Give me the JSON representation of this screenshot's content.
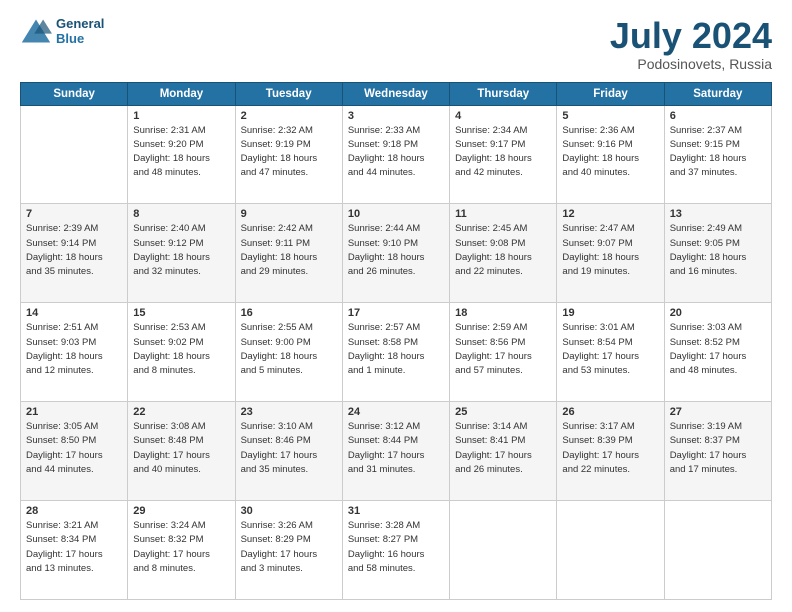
{
  "logo": {
    "line1": "General",
    "line2": "Blue"
  },
  "title": "July 2024",
  "subtitle": "Podosinovets, Russia",
  "header_days": [
    "Sunday",
    "Monday",
    "Tuesday",
    "Wednesday",
    "Thursday",
    "Friday",
    "Saturday"
  ],
  "weeks": [
    [
      {
        "day": "",
        "info": ""
      },
      {
        "day": "1",
        "info": "Sunrise: 2:31 AM\nSunset: 9:20 PM\nDaylight: 18 hours\nand 48 minutes."
      },
      {
        "day": "2",
        "info": "Sunrise: 2:32 AM\nSunset: 9:19 PM\nDaylight: 18 hours\nand 47 minutes."
      },
      {
        "day": "3",
        "info": "Sunrise: 2:33 AM\nSunset: 9:18 PM\nDaylight: 18 hours\nand 44 minutes."
      },
      {
        "day": "4",
        "info": "Sunrise: 2:34 AM\nSunset: 9:17 PM\nDaylight: 18 hours\nand 42 minutes."
      },
      {
        "day": "5",
        "info": "Sunrise: 2:36 AM\nSunset: 9:16 PM\nDaylight: 18 hours\nand 40 minutes."
      },
      {
        "day": "6",
        "info": "Sunrise: 2:37 AM\nSunset: 9:15 PM\nDaylight: 18 hours\nand 37 minutes."
      }
    ],
    [
      {
        "day": "7",
        "info": "Sunrise: 2:39 AM\nSunset: 9:14 PM\nDaylight: 18 hours\nand 35 minutes."
      },
      {
        "day": "8",
        "info": "Sunrise: 2:40 AM\nSunset: 9:12 PM\nDaylight: 18 hours\nand 32 minutes."
      },
      {
        "day": "9",
        "info": "Sunrise: 2:42 AM\nSunset: 9:11 PM\nDaylight: 18 hours\nand 29 minutes."
      },
      {
        "day": "10",
        "info": "Sunrise: 2:44 AM\nSunset: 9:10 PM\nDaylight: 18 hours\nand 26 minutes."
      },
      {
        "day": "11",
        "info": "Sunrise: 2:45 AM\nSunset: 9:08 PM\nDaylight: 18 hours\nand 22 minutes."
      },
      {
        "day": "12",
        "info": "Sunrise: 2:47 AM\nSunset: 9:07 PM\nDaylight: 18 hours\nand 19 minutes."
      },
      {
        "day": "13",
        "info": "Sunrise: 2:49 AM\nSunset: 9:05 PM\nDaylight: 18 hours\nand 16 minutes."
      }
    ],
    [
      {
        "day": "14",
        "info": "Sunrise: 2:51 AM\nSunset: 9:03 PM\nDaylight: 18 hours\nand 12 minutes."
      },
      {
        "day": "15",
        "info": "Sunrise: 2:53 AM\nSunset: 9:02 PM\nDaylight: 18 hours\nand 8 minutes."
      },
      {
        "day": "16",
        "info": "Sunrise: 2:55 AM\nSunset: 9:00 PM\nDaylight: 18 hours\nand 5 minutes."
      },
      {
        "day": "17",
        "info": "Sunrise: 2:57 AM\nSunset: 8:58 PM\nDaylight: 18 hours\nand 1 minute."
      },
      {
        "day": "18",
        "info": "Sunrise: 2:59 AM\nSunset: 8:56 PM\nDaylight: 17 hours\nand 57 minutes."
      },
      {
        "day": "19",
        "info": "Sunrise: 3:01 AM\nSunset: 8:54 PM\nDaylight: 17 hours\nand 53 minutes."
      },
      {
        "day": "20",
        "info": "Sunrise: 3:03 AM\nSunset: 8:52 PM\nDaylight: 17 hours\nand 48 minutes."
      }
    ],
    [
      {
        "day": "21",
        "info": "Sunrise: 3:05 AM\nSunset: 8:50 PM\nDaylight: 17 hours\nand 44 minutes."
      },
      {
        "day": "22",
        "info": "Sunrise: 3:08 AM\nSunset: 8:48 PM\nDaylight: 17 hours\nand 40 minutes."
      },
      {
        "day": "23",
        "info": "Sunrise: 3:10 AM\nSunset: 8:46 PM\nDaylight: 17 hours\nand 35 minutes."
      },
      {
        "day": "24",
        "info": "Sunrise: 3:12 AM\nSunset: 8:44 PM\nDaylight: 17 hours\nand 31 minutes."
      },
      {
        "day": "25",
        "info": "Sunrise: 3:14 AM\nSunset: 8:41 PM\nDaylight: 17 hours\nand 26 minutes."
      },
      {
        "day": "26",
        "info": "Sunrise: 3:17 AM\nSunset: 8:39 PM\nDaylight: 17 hours\nand 22 minutes."
      },
      {
        "day": "27",
        "info": "Sunrise: 3:19 AM\nSunset: 8:37 PM\nDaylight: 17 hours\nand 17 minutes."
      }
    ],
    [
      {
        "day": "28",
        "info": "Sunrise: 3:21 AM\nSunset: 8:34 PM\nDaylight: 17 hours\nand 13 minutes."
      },
      {
        "day": "29",
        "info": "Sunrise: 3:24 AM\nSunset: 8:32 PM\nDaylight: 17 hours\nand 8 minutes."
      },
      {
        "day": "30",
        "info": "Sunrise: 3:26 AM\nSunset: 8:29 PM\nDaylight: 17 hours\nand 3 minutes."
      },
      {
        "day": "31",
        "info": "Sunrise: 3:28 AM\nSunset: 8:27 PM\nDaylight: 16 hours\nand 58 minutes."
      },
      {
        "day": "",
        "info": ""
      },
      {
        "day": "",
        "info": ""
      },
      {
        "day": "",
        "info": ""
      }
    ]
  ]
}
